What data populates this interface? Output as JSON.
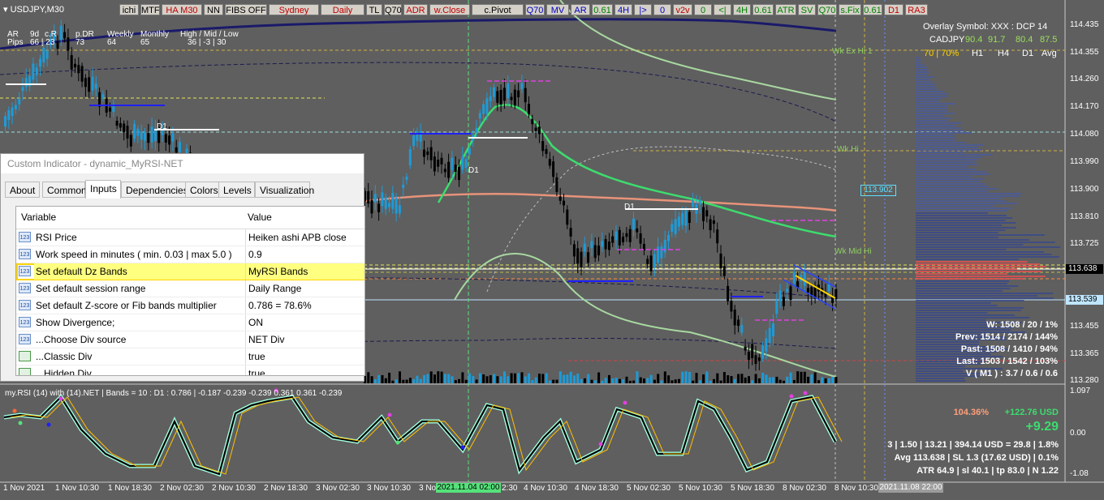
{
  "chart": {
    "symbol": "USDJPY,M30",
    "toolbar": [
      "ichi",
      "MTF",
      "HA M30",
      "NN",
      "FIBS OFF",
      "Sydney",
      "Daily",
      "TL",
      "Q70",
      "ADR",
      "w.Close",
      "c.Pivot",
      "Q70",
      "MV",
      "AR",
      "0.61",
      "4H",
      "|>",
      "0",
      "v2v",
      "0",
      "<|",
      "4H",
      "0.61",
      "ATR",
      "SV",
      "Q70",
      "s.Fix",
      "0.61",
      "D1",
      "RA3"
    ],
    "info": {
      "row1": [
        "AR",
        "9d",
        "c.R",
        "p.DR",
        "Weekly",
        "Monthly",
        "High / Mid / Low"
      ],
      "row2": [
        "Pips",
        "66 | 23",
        "73",
        "64",
        "65",
        "36 | -3 | 30"
      ]
    },
    "overlay": {
      "line1": "Overlay Symbol: XXX : DCP 14",
      "cadjpy": "CADJPY",
      "cad_vals": [
        "90.4",
        "91.7",
        "80.4",
        "87.5"
      ],
      "pct": "70 | 70%",
      "tfs": [
        "H1",
        "H4",
        "D1",
        "Avg"
      ]
    },
    "level_labels": {
      "wk_ex_hi": "Wk Ex Hi 1",
      "wk_hi": "Wk Hi",
      "wk_mid": "Wk Mid Hi",
      "d1": "D1"
    },
    "price_axis": [
      "114.435",
      "114.355",
      "114.260",
      "114.170",
      "114.080",
      "113.990",
      "113.900",
      "113.810",
      "113.725",
      "113.635",
      "113.545",
      "113.455",
      "113.365",
      "113.280"
    ],
    "price_box": "113.902",
    "current_price": "113.638",
    "bid_price": "113.539",
    "stats": {
      "w": "W: 1508 / 20 / 1%",
      "prev": "Prev: 1514 / 2174 / 144%",
      "past": "Past: 1508 / 1410 / 94%",
      "last": "Last: 1503 / 1542 / 103%",
      "v": "V ( M1 ) : 3.7 / 0.6 / 0.6"
    },
    "rsi_label": "my.RSI (14) with (14).NET | Bands = 10 : D1 : 0.786 | -0.187 -0.239 -0.239 0.361 0.361 -0.239",
    "rsi_axis": [
      "1.097",
      "0.00",
      "-1.08"
    ],
    "pl": {
      "pct": "104.36%",
      "usd": "+122.76 USD",
      "pips": "+9.29"
    },
    "trade": {
      "line1": "3  |  1.50  |  13.21  |  394.14 USD = 29.8  |  1.8%",
      "line2": "Avg 113.638  |  SL 1.3 (17.62 USD)  |  0.1%",
      "line3": "ATR 64.9  |  sl 40.1  |  tp 83.0  |  N 1.22"
    },
    "time_axis": [
      "1 Nov 2021",
      "1 Nov 10:30",
      "1 Nov 18:30",
      "2 Nov 02:30",
      "2 Nov 10:30",
      "2 Nov 18:30",
      "3 Nov 02:30",
      "3 Nov 10:30",
      "3 No",
      "2:30",
      "4 Nov 10:30",
      "4 Nov 18:30",
      "5 Nov 02:30",
      "5 Nov 10:30",
      "5 Nov 18:30",
      "8 Nov 02:30",
      "8 Nov 10:30"
    ],
    "time_tag1": "2021.11.04 02:00",
    "time_tag2": "2021.11.08 22:00"
  },
  "dialog": {
    "title": "Custom Indicator - dynamic_MyRSI-NET",
    "tabs": [
      "About",
      "Common",
      "Inputs",
      "Dependencies",
      "Colors",
      "Levels",
      "Visualization"
    ],
    "active_tab": "Inputs",
    "headers": {
      "variable": "Variable",
      "value": "Value"
    },
    "rows": [
      {
        "icon": "123",
        "name": "RSI Price",
        "value": "Heiken ashi APB close"
      },
      {
        "icon": "123",
        "name": "Work speed in minutes ( min. 0.03 | max 5.0 )",
        "value": "0.9"
      },
      {
        "icon": "123",
        "name": "Set default Dz Bands",
        "value": "MyRSI Bands"
      },
      {
        "icon": "123",
        "name": "Set default session range",
        "value": "Daily Range"
      },
      {
        "icon": "123",
        "name": "Set default Z-score or Fib bands multiplier",
        "value": "0.786 = 78.6%"
      },
      {
        "icon": "123",
        "name": "Show Divergence;",
        "value": "ON"
      },
      {
        "icon": "123",
        "name": "...Choose Div source",
        "value": "NET Div"
      },
      {
        "icon": "bool",
        "name": "...Classic Div",
        "value": "true"
      },
      {
        "icon": "bool",
        "name": "...Hidden Div",
        "value": "true"
      }
    ]
  },
  "colors": {
    "bg": "#5f5f5f",
    "bull": "#1e9bd7",
    "bear": "#000000",
    "ma_green": "#3ddc6e",
    "ma_salmon": "#e8937a",
    "ma_light": "#a8d8a0",
    "highlight": "#ffff80"
  }
}
